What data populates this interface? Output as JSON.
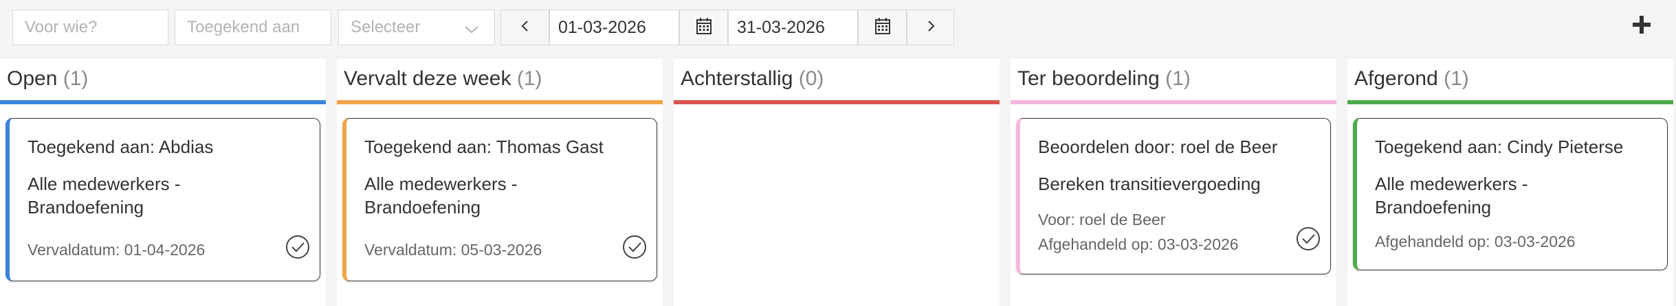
{
  "toolbar": {
    "who_placeholder": "Voor wie?",
    "assigned_placeholder": "Toegekend aan",
    "select_placeholder": "Selecteer",
    "date_from": "01-03-2026",
    "date_to": "31-03-2026",
    "icons": {
      "prev": "chevron-left-icon",
      "next": "chevron-right-icon",
      "calendar": "calendar-icon",
      "add": "plus-icon",
      "dropdown": "chevron-down-icon",
      "check": "check-circle-icon"
    }
  },
  "columns": [
    {
      "title": "Open",
      "count": "(1)",
      "color": "#3a83db",
      "cards": [
        {
          "assigned": "Toegekend aan: Abdias",
          "task_line1": "Alle medewerkers -",
          "task_line2": "Brandoefening",
          "meta": "Vervaldatum: 01-04-2026"
        }
      ]
    },
    {
      "title": "Vervalt deze week",
      "count": "(1)",
      "color": "#f0a448",
      "cards": [
        {
          "assigned": "Toegekend aan: Thomas Gast",
          "task_line1": "Alle medewerkers -",
          "task_line2": "Brandoefening",
          "meta": "Vervaldatum: 05-03-2026"
        }
      ]
    },
    {
      "title": "Achterstallig",
      "count": "(0)",
      "color": "#d9534f",
      "cards": []
    },
    {
      "title": "Ter beoordeling",
      "count": "(1)",
      "color": "#f2b8de",
      "cards": [
        {
          "assigned": "Beoordelen door: roel de Beer",
          "task_line1": "Bereken transitievergoeding",
          "meta_line1": "Voor: roel de Beer",
          "meta_line2": "Afgehandeld op: 03-03-2026"
        }
      ]
    },
    {
      "title": "Afgerond",
      "count": "(1)",
      "color": "#4caa4a",
      "cards": [
        {
          "assigned": "Toegekend aan: Cindy Pieterse",
          "task_line1": "Alle medewerkers -",
          "task_line2": "Brandoefening",
          "meta": "Afgehandeld op: 03-03-2026"
        }
      ]
    }
  ]
}
